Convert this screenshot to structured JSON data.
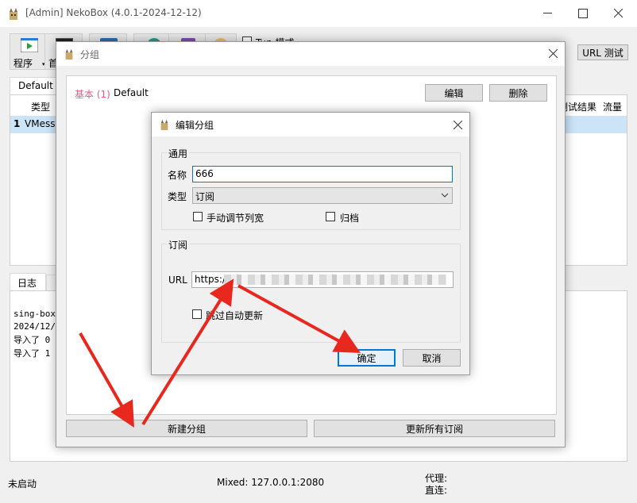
{
  "main_window": {
    "title": "[Admin] NekoBox (4.0.1-2024-12-12)",
    "toolbar": {
      "program_label": "程序",
      "second_label_partial": "首",
      "tun_label": "Tun 模式",
      "url_test_label": "URL 测试"
    },
    "group_tab": "Default",
    "table": {
      "col_type": "类型",
      "col_test_result": "测试结果",
      "col_traffic": "流量",
      "row_index": "1",
      "row_type": "VMess"
    },
    "log": {
      "tab": "日志",
      "lines": [
        "sing-box",
        "2024/12/",
        "导入了 0",
        "导入了 1"
      ]
    },
    "status": {
      "state": "未启动",
      "mixed": "Mixed: 127.0.0.1:2080",
      "proxy": "代理:",
      "direct": "直连:"
    }
  },
  "groups_dialog": {
    "title": "分组",
    "group_tag": "基本 (1)",
    "group_name": "Default",
    "edit_button": "编辑",
    "delete_button": "删除",
    "new_group_button": "新建分组",
    "update_all_button": "更新所有订阅"
  },
  "edit_dialog": {
    "title": "编辑分组",
    "general_section": "通用",
    "name_label": "名称",
    "name_value": "666",
    "type_label": "类型",
    "type_value": "订阅",
    "manual_col_width": "手动调节列宽",
    "archive": "归档",
    "subscription_section": "订阅",
    "url_label": "URL",
    "url_value": "https:/",
    "skip_auto_update": "跳过自动更新",
    "ok_button": "确定",
    "cancel_button": "取消"
  },
  "colors": {
    "accent_blue": "#0078d7",
    "group_tag_pink": "#e05c8a",
    "annotation_red": "#e8281e"
  }
}
